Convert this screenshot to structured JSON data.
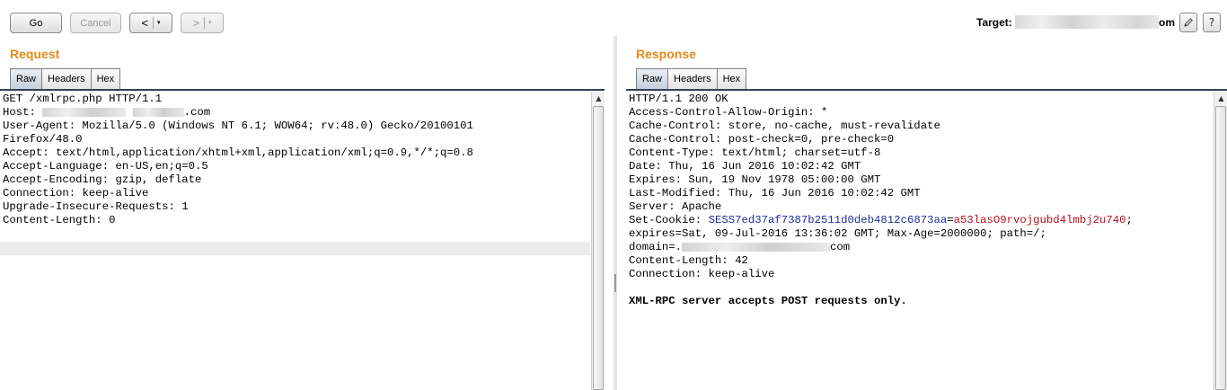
{
  "toolbar": {
    "go_label": "Go",
    "cancel_label": "Cancel",
    "back_symbol": "<",
    "forward_symbol": ">",
    "dropdown_symbol": "▾",
    "target_label": "Target:",
    "target_suffix": "om",
    "edit_icon": "pencil-icon",
    "help_label": "?"
  },
  "request": {
    "title": "Request",
    "tabs": [
      {
        "label": "Raw",
        "active": true
      },
      {
        "label": "Headers",
        "active": false
      },
      {
        "label": "Hex",
        "active": false
      }
    ],
    "lines": [
      "GET /xmlrpc.php HTTP/1.1",
      "Host: ",
      "User-Agent: Mozilla/5.0 (Windows NT 6.1; WOW64; rv:48.0) Gecko/20100101",
      "Firefox/48.0",
      "Accept: text/html,application/xhtml+xml,application/xml;q=0.9,*/*;q=0.8",
      "Accept-Language: en-US,en;q=0.5",
      "Accept-Encoding: gzip, deflate",
      "Connection: keep-alive",
      "Upgrade-Insecure-Requests: 1",
      "Content-Length: 0"
    ],
    "host_suffix": ".com"
  },
  "response": {
    "title": "Response",
    "tabs": [
      {
        "label": "Raw",
        "active": true
      },
      {
        "label": "Headers",
        "active": false
      },
      {
        "label": "Hex",
        "active": false
      }
    ],
    "lines": [
      "HTTP/1.1 200 OK",
      "Access-Control-Allow-Origin: *",
      "Cache-Control: store, no-cache, must-revalidate",
      "Cache-Control: post-check=0, pre-check=0",
      "Content-Type: text/html; charset=utf-8",
      "Date: Thu, 16 Jun 2016 10:02:42 GMT",
      "Expires: Sun, 19 Nov 1978 05:00:00 GMT",
      "Last-Modified: Thu, 16 Jun 2016 10:02:42 GMT",
      "Server: Apache"
    ],
    "set_cookie_prefix": "Set-Cookie: ",
    "cookie_name": "SESS7ed37af7387b2511d0deb4812c6873aa",
    "cookie_eq": "=",
    "cookie_value": "a53lasO9rvojgubd4lmbj2u740",
    "cookie_semicolon": ";",
    "cookie_line2": "expires=Sat, 09-Jul-2016 13:36:02 GMT; Max-Age=2000000; path=/;",
    "domain_prefix": "domain=.",
    "domain_suffix": "com",
    "content_length": "Content-Length: 42",
    "connection": "Connection: keep-alive",
    "body": "XML-RPC server accepts POST requests only."
  }
}
